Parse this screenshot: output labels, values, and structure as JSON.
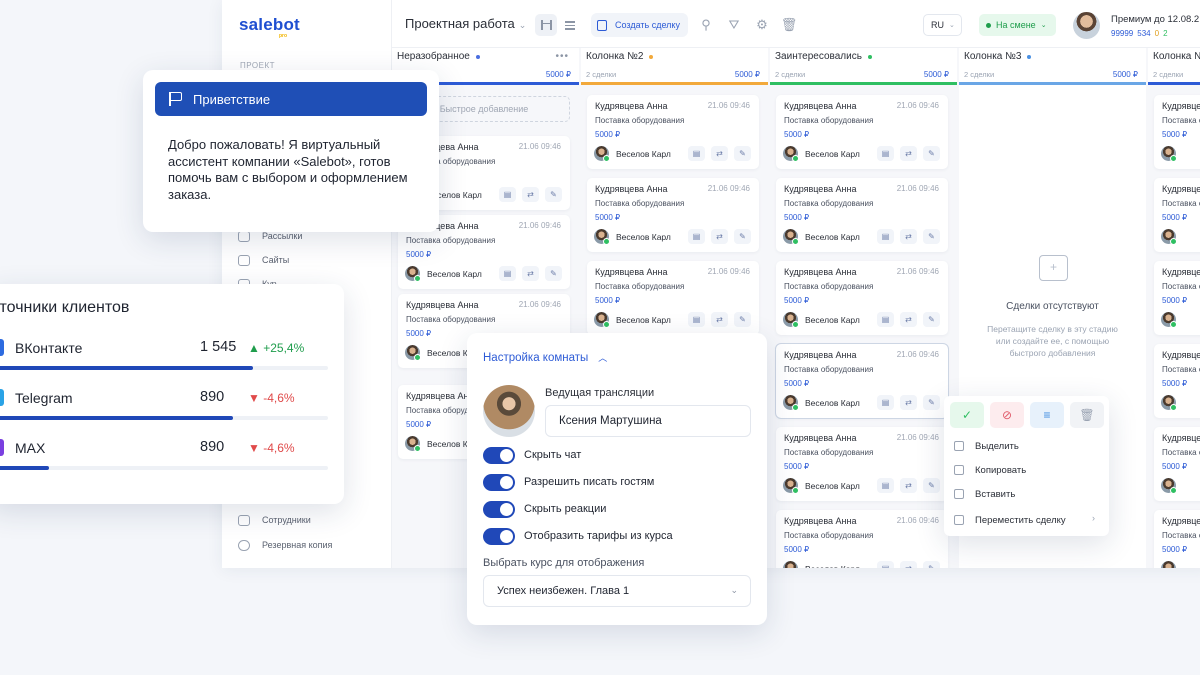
{
  "app": {
    "logo": "salebot",
    "logo_sub": "pro",
    "project_title": "Проектная работа",
    "create_deal": "Создать сделку",
    "lang": "RU",
    "shift": "На смене",
    "premium": "Премиум до 12.08.2",
    "counters": {
      "a": "99999",
      "b": "534",
      "c": "0",
      "d": "2"
    },
    "sidebar_category": "ПРОЕКТ",
    "sidebar_items": [
      {
        "label": "Рассылки",
        "icon": "mail-icon"
      },
      {
        "label": "Сайты",
        "icon": "site-icon"
      },
      {
        "label": "Кур...",
        "icon": "course-icon"
      },
      {
        "label": "Сотрудники",
        "icon": "staff-icon"
      },
      {
        "label": "Резервная копия",
        "icon": "cloud-icon"
      }
    ]
  },
  "columns": [
    {
      "title": "Неразобранное",
      "dot": "#4a6ee0",
      "count": "",
      "sum": "5000 ₽",
      "line": "#2d5bd6",
      "quick_add": "Быстрое добавление"
    },
    {
      "title": "Колонка №2",
      "dot": "#f2a93b",
      "count": "2 сделки",
      "sum": "5000 ₽",
      "line": "#f2a93b"
    },
    {
      "title": "Заинтересовались",
      "dot": "#2fbf62",
      "count": "2 сделки",
      "sum": "5000 ₽",
      "line": "#2fbf62"
    },
    {
      "title": "Колонка №3",
      "dot": "#4a90e2",
      "count": "2 сделки",
      "sum": "5000 ₽",
      "line": "#6aa6e6"
    },
    {
      "title": "Колонка №",
      "dot": "",
      "count": "2 сделки",
      "sum": "5000 ₽",
      "line": "#2d5bd6"
    }
  ],
  "card": {
    "name": "Кудрявцева Анна",
    "date": "21.06 09:46",
    "product": "Поставка оборудования",
    "money": "5000 ₽",
    "manager": "Веселов Карл"
  },
  "empty_state": {
    "title": "Сделки отсутствуют",
    "hint": "Перетащите сделку в эту стадию или создайте ее, с помощью быстрого добавления"
  },
  "greeting": {
    "title": "Приветствие",
    "text": "Добро пожаловать! Я виртуальный ассистент компании «Salebot», готов помочь вам с выбором и оформлением заказа."
  },
  "sources": {
    "title": "Источники клиентов",
    "rows": [
      {
        "name": "ВКонтакте",
        "value": "1 545",
        "change": "▲ +25,4%",
        "up": true,
        "color": "#2d6be0",
        "progress": 0.78
      },
      {
        "name": "Telegram",
        "value": "890",
        "change": "▼ -4,6%",
        "up": false,
        "color": "#2aa3e6",
        "progress": 0.72
      },
      {
        "name": "MAX",
        "value": "890",
        "change": "▼ -4,6%",
        "up": false,
        "color": "#7a3fe0",
        "progress": 0.18
      }
    ]
  },
  "room": {
    "title": "Настройка комнаты",
    "host_label": "Ведущая трансляции",
    "host_name": "Ксения Мартушина",
    "toggles": [
      "Скрыть чат",
      "Разрешить писать гостям",
      "Скрыть реакции",
      "Отобразить тарифы из курса"
    ],
    "course_label": "Выбрать курс для отображения",
    "course_value": "Успех неизбежен. Глава 1"
  },
  "context_menu": {
    "items": [
      "Выделить",
      "Копировать",
      "Вставить",
      "Переместить сделку"
    ]
  }
}
